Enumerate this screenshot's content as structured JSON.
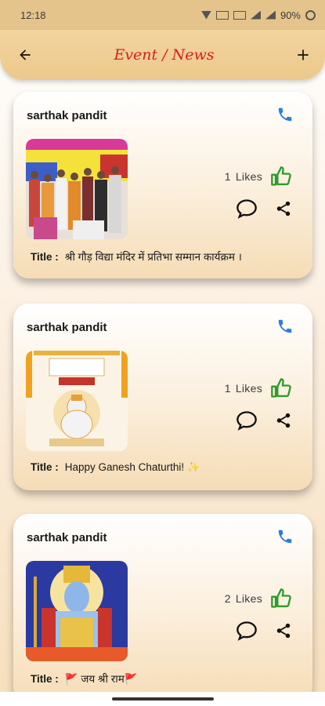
{
  "status_bar": {
    "time": "12:18",
    "battery": "90%"
  },
  "header": {
    "title": "Event / News",
    "back_icon": "arrow-back-icon",
    "add_icon": "plus-icon"
  },
  "posts": [
    {
      "username": "sarthak pandit",
      "likes_count": "1",
      "likes_label": "Likes",
      "title_label": "Title :",
      "title_text": "श्री गौड़ विद्या मंदिर में प्रतिभा  सम्मान कार्यक्रम ।",
      "image_desc": "photo-award-ceremony"
    },
    {
      "username": "sarthak pandit",
      "likes_count": "1",
      "likes_label": "Likes",
      "title_label": "Title :",
      "title_text": "Happy Ganesh Chaturthi! ✨",
      "image_desc": "photo-ganesh-chaturthi"
    },
    {
      "username": "sarthak pandit",
      "likes_count": "2",
      "likes_label": "Likes",
      "title_label": "Title :",
      "title_text": "🚩 जय श्री राम🚩",
      "image_desc": "photo-shri-ram"
    }
  ],
  "colors": {
    "accent_title": "#d81e1e",
    "phone_icon": "#2a7de1",
    "like_icon": "#2e9a2e",
    "appbar": "#ecc98c"
  }
}
